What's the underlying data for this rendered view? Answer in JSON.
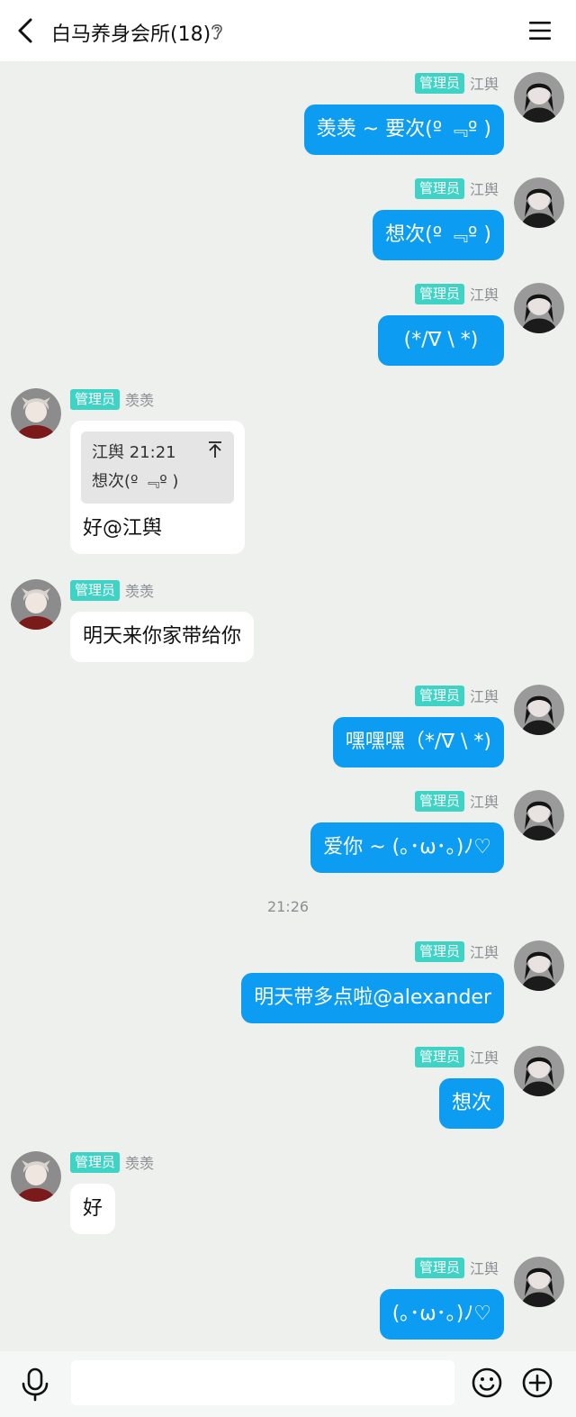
{
  "header": {
    "title": "白马养身会所(18)",
    "back_icon": "chevron-left-icon",
    "ear_icon": "ear-icon",
    "menu_icon": "hamburger-menu-icon"
  },
  "colors": {
    "outgoing_bubble": "#0c9cf2",
    "badge": "#3fd3c5",
    "chat_background": "#edf0ed"
  },
  "messages": [
    {
      "direction": "out",
      "badge": "管理员",
      "sender": "江舆",
      "text": "羡羡 ~ 要次(º ﹃º )"
    },
    {
      "direction": "out",
      "badge": "管理员",
      "sender": "江舆",
      "text": "想次(º ﹃º )"
    },
    {
      "direction": "out",
      "badge": "管理员",
      "sender": "江舆",
      "text": "(*/∇ \\ *)"
    },
    {
      "direction": "in",
      "badge": "管理员",
      "sender": "羡羡",
      "quote": {
        "author_time": "江舆 21:21",
        "text": "想次(º ﹃º )"
      },
      "text": "好@江舆"
    },
    {
      "direction": "in",
      "badge": "管理员",
      "sender": "羡羡",
      "text": "明天来你家带给你"
    },
    {
      "direction": "out",
      "badge": "管理员",
      "sender": "江舆",
      "text": "嘿嘿嘿（*/∇ \\ *)"
    },
    {
      "direction": "out",
      "badge": "管理员",
      "sender": "江舆",
      "text": "爱你 ~ (｡･ω･｡)ﾉ♡"
    },
    {
      "direction": "out",
      "badge": "管理员",
      "sender": "江舆",
      "text": "明天带多点啦@alexander"
    },
    {
      "direction": "out",
      "badge": "管理员",
      "sender": "江舆",
      "text": "想次"
    },
    {
      "direction": "in",
      "badge": "管理员",
      "sender": "羡羡",
      "text": "好"
    },
    {
      "direction": "out",
      "badge": "管理员",
      "sender": "江舆",
      "text": "(｡･ω･｡)ﾉ♡"
    }
  ],
  "timestamp": "21:26",
  "input": {
    "placeholder": "",
    "value": ""
  },
  "input_icons": [
    "microphone-icon",
    "emoji-icon",
    "plus-icon"
  ]
}
